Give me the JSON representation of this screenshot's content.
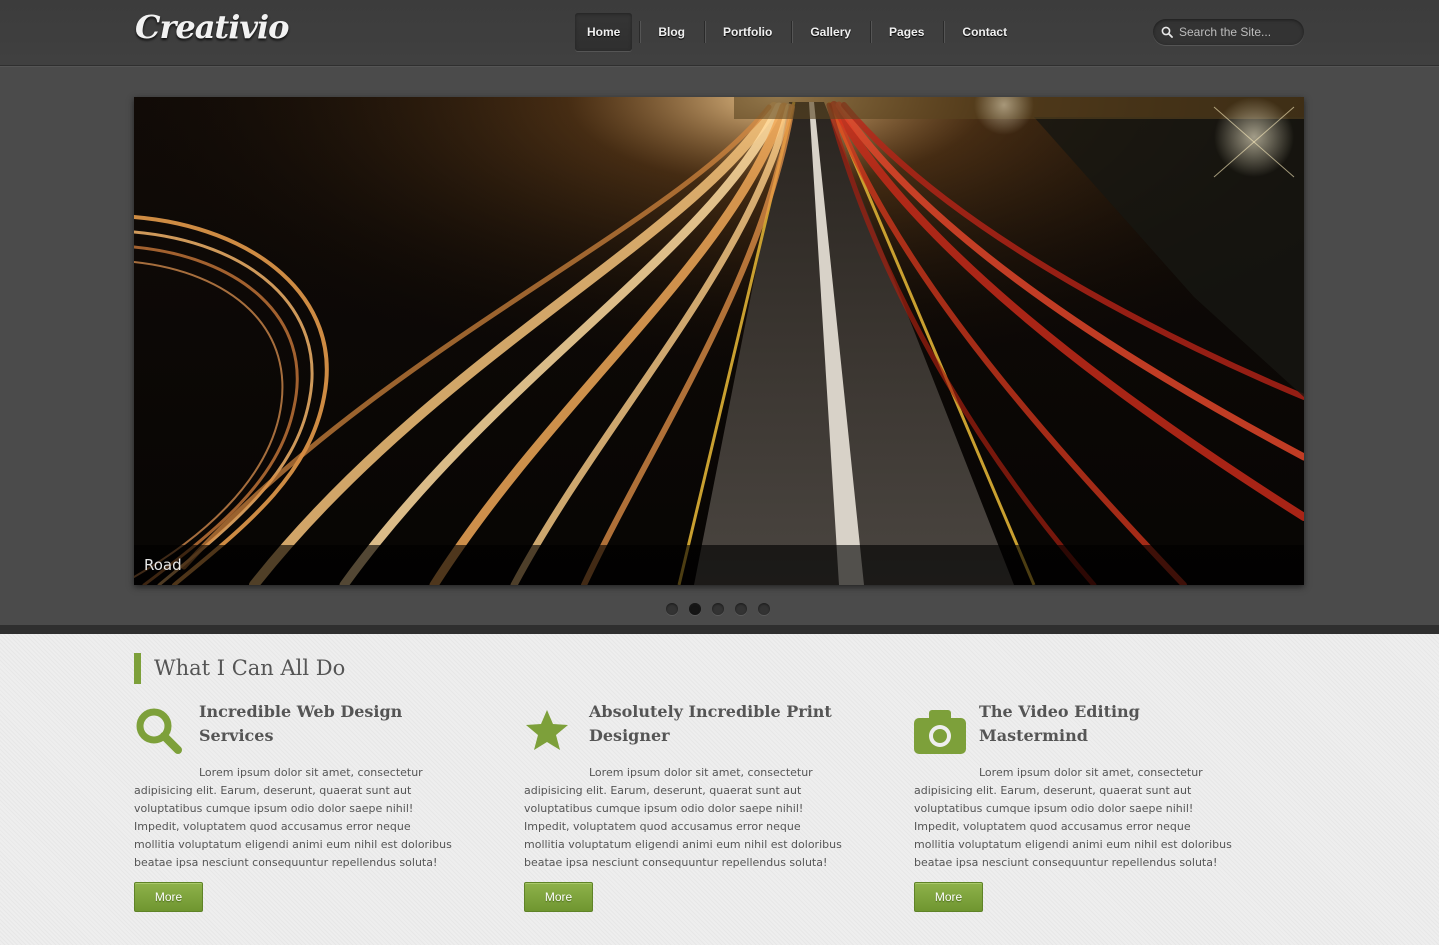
{
  "header": {
    "logo": "Creativio",
    "nav": [
      "Home",
      "Blog",
      "Portfolio",
      "Gallery",
      "Pages",
      "Contact"
    ],
    "active_nav": "Home",
    "search_placeholder": "Search the Site..."
  },
  "slider": {
    "caption": "Road",
    "dot_count": 5,
    "active_dot": 2
  },
  "services": {
    "title": "What I Can All Do",
    "items": [
      {
        "icon": "search-icon",
        "heading": "Incredible Web Design Services",
        "text": "Lorem ipsum dolor sit amet, consectetur adipisicing elit. Earum, deserunt, quaerat sunt aut voluptatibus cumque ipsum odio dolor saepe nihil! Impedit, voluptatem quod accusamus error neque mollitia voluptatum eligendi animi eum nihil est doloribus beatae ipsa nesciunt consequuntur repellendus soluta!",
        "button": "More"
      },
      {
        "icon": "star-icon",
        "heading": "Absolutely Incredible Print Designer",
        "text": "Lorem ipsum dolor sit amet, consectetur adipisicing elit. Earum, deserunt, quaerat sunt aut voluptatibus cumque ipsum odio dolor saepe nihil! Impedit, voluptatem quod accusamus error neque mollitia voluptatum eligendi animi eum nihil est doloribus beatae ipsa nesciunt consequuntur repellendus soluta!",
        "button": "More"
      },
      {
        "icon": "camera-icon",
        "heading": "The Video Editing Mastermind",
        "text": "Lorem ipsum dolor sit amet, consectetur adipisicing elit. Earum, deserunt, quaerat sunt aut voluptatibus cumque ipsum odio dolor saepe nihil! Impedit, voluptatem quod accusamus error neque mollitia voluptatum eligendi animi eum nihil est doloribus beatae ipsa nesciunt consequuntur repellendus soluta!",
        "button": "More"
      }
    ]
  },
  "colors": {
    "accent": "#7da03a",
    "header_bg": "#3e3e3e",
    "content_bg": "#eeeeee"
  }
}
